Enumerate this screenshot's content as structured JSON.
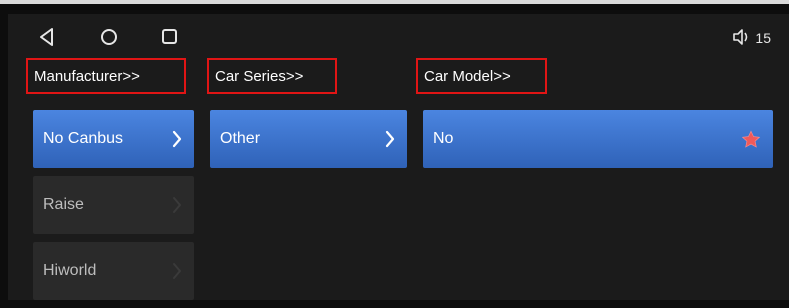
{
  "navbar": {
    "back_icon": "triangle-back-icon",
    "home_icon": "circle-home-icon",
    "recents_icon": "square-recents-icon"
  },
  "status": {
    "volume_icon": "speaker-icon",
    "volume_level": "15"
  },
  "headers": {
    "manufacturer": "Manufacturer>>",
    "series": "Car Series>>",
    "model": "Car Model>>"
  },
  "manufacturer_list": [
    {
      "label": "No Canbus",
      "selected": true
    },
    {
      "label": "Raise",
      "selected": false
    },
    {
      "label": "Hiworld",
      "selected": false
    }
  ],
  "series_list": [
    {
      "label": "Other",
      "selected": true
    }
  ],
  "model_list": [
    {
      "label": "No",
      "selected": true,
      "favorite": true
    }
  ],
  "colors": {
    "accent_blue": "#3f78d6",
    "highlight_red": "#e01515",
    "star_red": "#f05a5a",
    "background": "#1b1b1b"
  }
}
